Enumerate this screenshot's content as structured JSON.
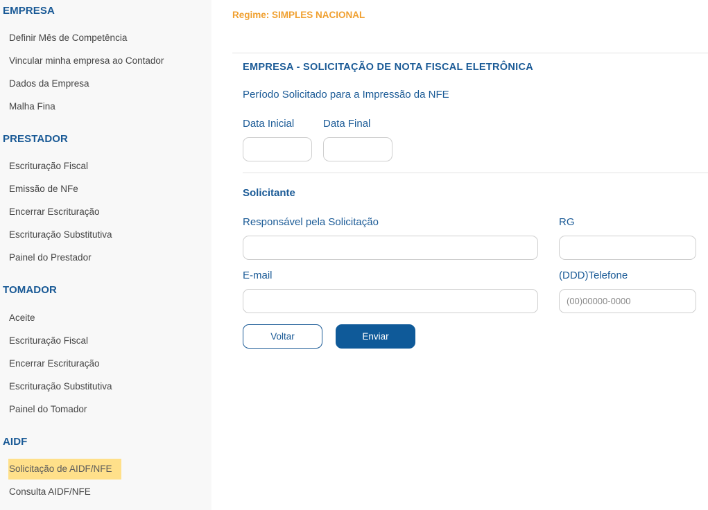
{
  "sidebar": {
    "sections": [
      {
        "title": "EMPRESA",
        "items": [
          "Definir Mês de Competência",
          "Vincular minha empresa ao Contador",
          "Dados da Empresa",
          "Malha Fina"
        ]
      },
      {
        "title": "PRESTADOR",
        "items": [
          "Escrituração Fiscal",
          "Emissão de NFe",
          "Encerrar Escrituração",
          "Escrituração Substitutiva",
          "Painel do Prestador"
        ]
      },
      {
        "title": "TOMADOR",
        "items": [
          "Aceite",
          "Escrituração Fiscal",
          "Encerrar Escrituração",
          "Escrituração Substitutiva",
          "Painel do Tomador"
        ]
      },
      {
        "title": "AIDF",
        "items": [
          "Solicitação de AIDF/NFE",
          "Consulta AIDF/NFE"
        ]
      }
    ],
    "active_item": "Solicitação de AIDF/NFE",
    "highlight_color": "#ffe08a"
  },
  "header": {
    "regime": "Regime: SIMPLES NACIONAL",
    "regime_color": "#f0a030"
  },
  "form": {
    "title": "EMPRESA - SOLICITAÇÃO DE NOTA FISCAL ELETRÔNICA",
    "periodo_label": "Período Solicitado para a Impressão da NFE",
    "data_inicial_label": "Data Inicial",
    "data_inicial_value": "",
    "data_final_label": "Data Final",
    "data_final_value": "",
    "solicitante_heading": "Solicitante",
    "responsavel_label": "Responsável pela Solicitação",
    "responsavel_value": "",
    "rg_label": "RG",
    "rg_value": "",
    "email_label": "E-mail",
    "email_value": "",
    "telefone_label": "(DDD)Telefone",
    "telefone_placeholder": "(00)00000-0000",
    "voltar_label": "Voltar",
    "enviar_label": "Enviar",
    "accent_color": "#1a5a96"
  }
}
